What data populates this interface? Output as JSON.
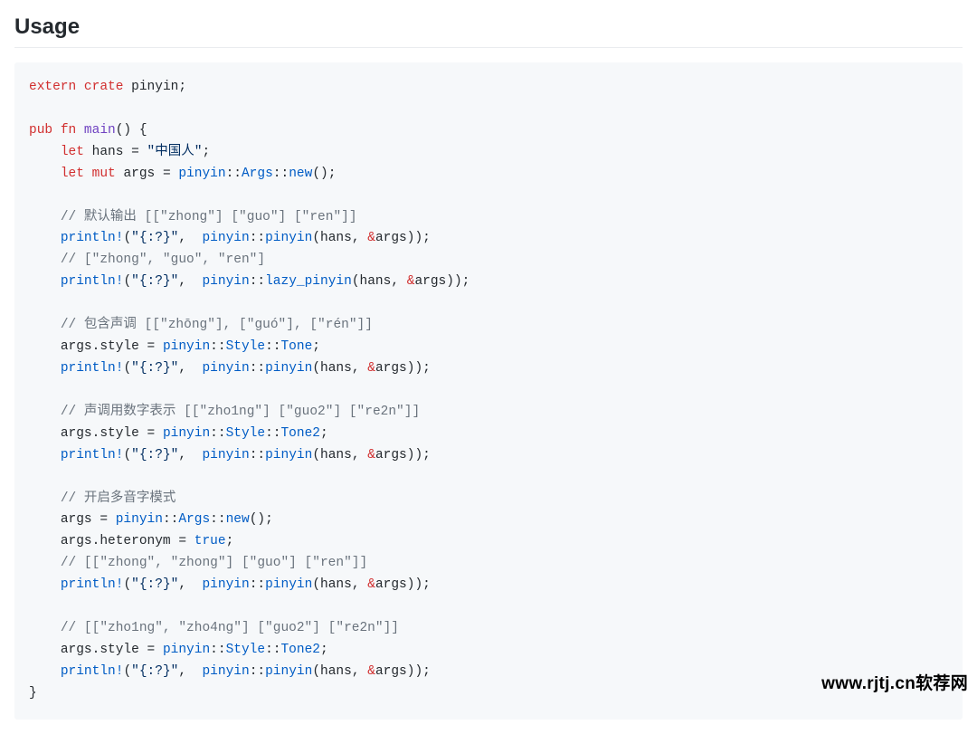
{
  "heading": "Usage",
  "watermark": "www.rjtj.cn软荐网",
  "code": {
    "l1": {
      "kw1": "extern",
      "kw2": "crate",
      "name": "pinyin"
    },
    "l3": {
      "kw1": "pub",
      "kw2": "fn",
      "fn": "main"
    },
    "l4": {
      "kw": "let",
      "var": "hans",
      "str": "\"中国人\""
    },
    "l5": {
      "kw1": "let",
      "kw2": "mut",
      "var": "args",
      "ns": "pinyin",
      "ty": "Args",
      "fn": "new"
    },
    "l7": {
      "cm": "// 默认输出 [[\"zhong\"] [\"guo\"] [\"ren\"]]"
    },
    "l8": {
      "mac": "println!",
      "fmt": "\"{:?}\"",
      "ns": "pinyin",
      "fn": "pinyin",
      "arg1": "hans",
      "amp": "&",
      "arg2": "args"
    },
    "l9": {
      "cm": "// [\"zhong\", \"guo\", \"ren\"]"
    },
    "l10": {
      "mac": "println!",
      "fmt": "\"{:?}\"",
      "ns": "pinyin",
      "fn": "lazy_pinyin",
      "arg1": "hans",
      "amp": "&",
      "arg2": "args"
    },
    "l12": {
      "cm": "// 包含声调 [[\"zhōng\"], [\"guó\"], [\"rén\"]]"
    },
    "l13": {
      "lhs": "args.style",
      "ns": "pinyin",
      "ty": "Style",
      "val": "Tone"
    },
    "l14": {
      "mac": "println!",
      "fmt": "\"{:?}\"",
      "ns": "pinyin",
      "fn": "pinyin",
      "arg1": "hans",
      "amp": "&",
      "arg2": "args"
    },
    "l16": {
      "cm": "// 声调用数字表示 [[\"zho1ng\"] [\"guo2\"] [\"re2n\"]]"
    },
    "l17": {
      "lhs": "args.style",
      "ns": "pinyin",
      "ty": "Style",
      "val": "Tone2"
    },
    "l18": {
      "mac": "println!",
      "fmt": "\"{:?}\"",
      "ns": "pinyin",
      "fn": "pinyin",
      "arg1": "hans",
      "amp": "&",
      "arg2": "args"
    },
    "l20": {
      "cm": "// 开启多音字模式"
    },
    "l21": {
      "lhs": "args",
      "ns": "pinyin",
      "ty": "Args",
      "fn": "new"
    },
    "l22": {
      "lhs": "args.heteronym",
      "val": "true"
    },
    "l23": {
      "cm": "// [[\"zhong\", \"zhong\"] [\"guo\"] [\"ren\"]]"
    },
    "l24": {
      "mac": "println!",
      "fmt": "\"{:?}\"",
      "ns": "pinyin",
      "fn": "pinyin",
      "arg1": "hans",
      "amp": "&",
      "arg2": "args"
    },
    "l26": {
      "cm": "// [[\"zho1ng\", \"zho4ng\"] [\"guo2\"] [\"re2n\"]]"
    },
    "l27": {
      "lhs": "args.style",
      "ns": "pinyin",
      "ty": "Style",
      "val": "Tone2"
    },
    "l28": {
      "mac": "println!",
      "fmt": "\"{:?}\"",
      "ns": "pinyin",
      "fn": "pinyin",
      "arg1": "hans",
      "amp": "&",
      "arg2": "args"
    }
  }
}
